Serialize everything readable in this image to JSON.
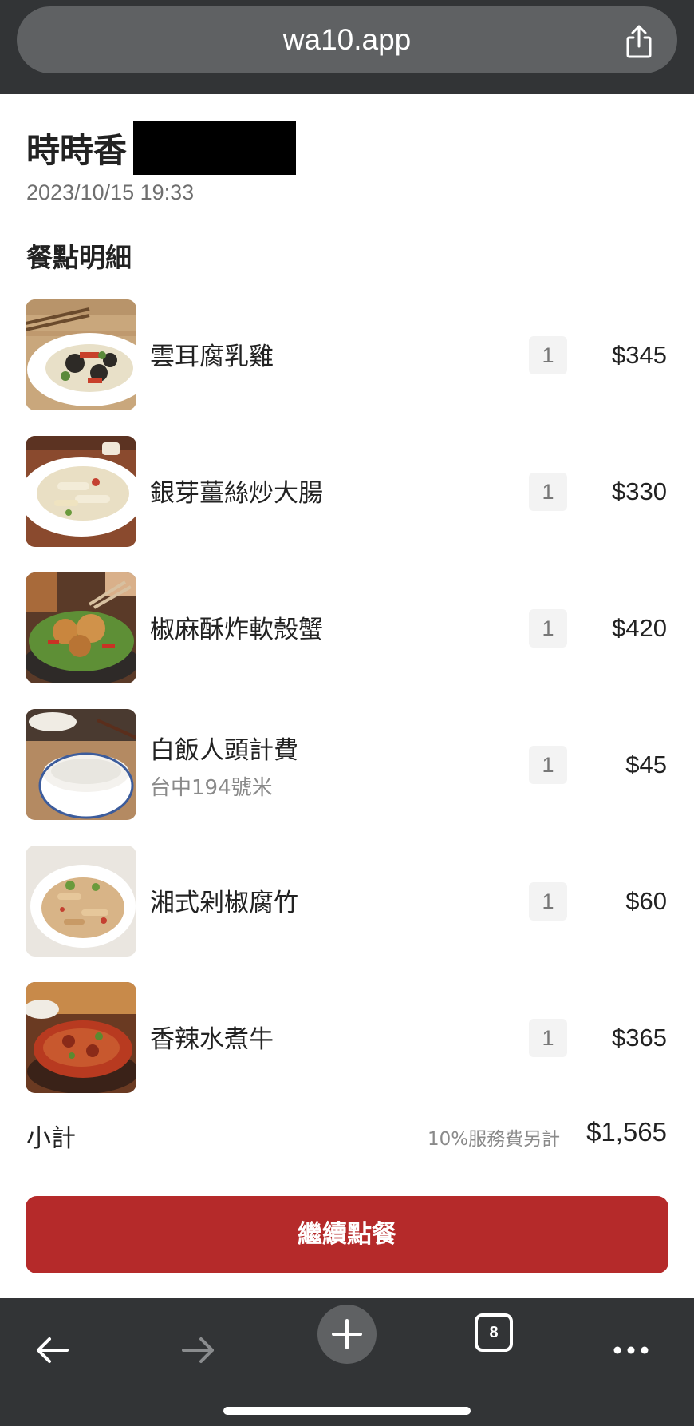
{
  "browser": {
    "url": "wa10.app",
    "tab_count": "8"
  },
  "header": {
    "restaurant": "時時香",
    "datetime": "2023/10/15 19:33"
  },
  "section_title": "餐點明細",
  "items": [
    {
      "name": "雲耳腐乳雞",
      "sub": "",
      "qty": "1",
      "price": "$345"
    },
    {
      "name": "銀芽薑絲炒大腸",
      "sub": "",
      "qty": "1",
      "price": "$330"
    },
    {
      "name": "椒麻酥炸軟殼蟹",
      "sub": "",
      "qty": "1",
      "price": "$420"
    },
    {
      "name": "白飯人頭計費",
      "sub": "台中194號米",
      "qty": "1",
      "price": "$45"
    },
    {
      "name": "湘式剁椒腐竹",
      "sub": "",
      "qty": "1",
      "price": "$60"
    },
    {
      "name": "香辣水煮牛",
      "sub": "",
      "qty": "1",
      "price": "$365"
    }
  ],
  "summary": {
    "label": "小計",
    "service_note": "10%服務費另計",
    "subtotal": "$1,565"
  },
  "continue_label": "繼續點餐",
  "colors": {
    "accent": "#b52a2a",
    "browser_chrome": "#323436",
    "url_pill": "#5f6163"
  },
  "icons": {
    "share": "share-icon",
    "back": "back-arrow-icon",
    "forward": "forward-arrow-icon",
    "new_tab": "plus-icon",
    "tabs": "tabs-icon",
    "more": "more-icon"
  }
}
